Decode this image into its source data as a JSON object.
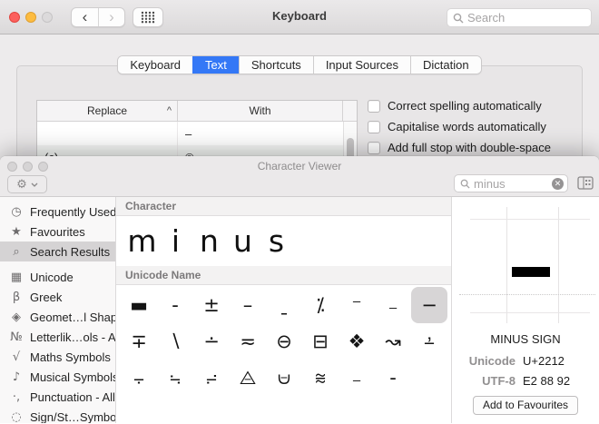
{
  "keyboard_window": {
    "title": "Keyboard",
    "search": {
      "placeholder": "Search"
    },
    "tabs": [
      "Keyboard",
      "Text",
      "Shortcuts",
      "Input Sources",
      "Dictation"
    ],
    "selected_tab": "Text",
    "table": {
      "columns": [
        "Replace",
        "With"
      ],
      "sort_column": "Replace",
      "sort_indicator": "^",
      "rows": [
        {
          "replace": "",
          "with": "–"
        },
        {
          "replace": "(c)",
          "with": "©"
        }
      ]
    },
    "checkboxes": [
      {
        "label": "Correct spelling automatically",
        "checked": false
      },
      {
        "label": "Capitalise words automatically",
        "checked": false
      },
      {
        "label": "Add full stop with double-space",
        "checked": false
      }
    ]
  },
  "character_viewer": {
    "title": "Character Viewer",
    "search": {
      "value": "minus"
    },
    "sidebar": {
      "groups": [
        {
          "items": [
            {
              "icon": "◷",
              "icon_name": "clock-icon",
              "label": "Frequently Used",
              "selected": false
            },
            {
              "icon": "★",
              "icon_name": "star-icon",
              "label": "Favourites",
              "selected": false
            },
            {
              "icon": "⌕",
              "icon_name": "magnifier-icon",
              "label": "Search Results",
              "selected": true
            }
          ]
        },
        {
          "items": [
            {
              "icon": "▦",
              "icon_name": "unicode-grid-icon",
              "label": "Unicode",
              "selected": false
            },
            {
              "icon": "β",
              "icon_name": "greek-beta-icon",
              "label": "Greek",
              "selected": false
            },
            {
              "icon": "◈",
              "icon_name": "diamond-icon",
              "label": "Geomet…l Shapes",
              "selected": false
            },
            {
              "icon": "№",
              "icon_name": "numero-icon",
              "label": "Letterlik…ols - All",
              "selected": false
            },
            {
              "icon": "√",
              "icon_name": "radical-icon",
              "label": "Maths Symbols",
              "selected": false
            },
            {
              "icon": "♪",
              "icon_name": "music-note-icon",
              "label": "Musical Symbols",
              "selected": false
            },
            {
              "icon": "·,",
              "icon_name": "punctuation-icon",
              "label": "Punctuation - All",
              "selected": false
            },
            {
              "icon": "◌",
              "icon_name": "dotted-circle-icon",
              "label": "Sign/St…Symbols",
              "selected": false
            }
          ]
        }
      ]
    },
    "sections": {
      "character": "Character",
      "unicode_name": "Unicode Name"
    },
    "character_results": [
      "m",
      "i",
      "n",
      "u",
      "s"
    ],
    "symbol_grid": {
      "rows": [
        [
          "▬",
          "-",
          "±",
          "–",
          "ˍ",
          "⁒",
          "⁻",
          "₋",
          "−"
        ],
        [
          "∓",
          "∖",
          "∸",
          "≂",
          "⊖",
          "⊟",
          "❖",
          "↝",
          "⨩"
        ],
        [
          "⨪",
          "⨫",
          "⨬",
          "⨺",
          "⩁",
          "⩬",
          "₋",
          "-"
        ]
      ],
      "selected": {
        "row": 0,
        "col": 8,
        "glyph": "−"
      }
    },
    "detail": {
      "name": "MINUS SIGN",
      "info": [
        {
          "label": "Unicode",
          "value": "U+2212"
        },
        {
          "label": "UTF-8",
          "value": "E2 88 92"
        }
      ],
      "add_button": "Add to Favourites"
    }
  },
  "colors": {
    "accent_blue": "#3478f6",
    "selection_gray": "#d5d3d4",
    "chrome_gray": "#ebe9ea"
  }
}
